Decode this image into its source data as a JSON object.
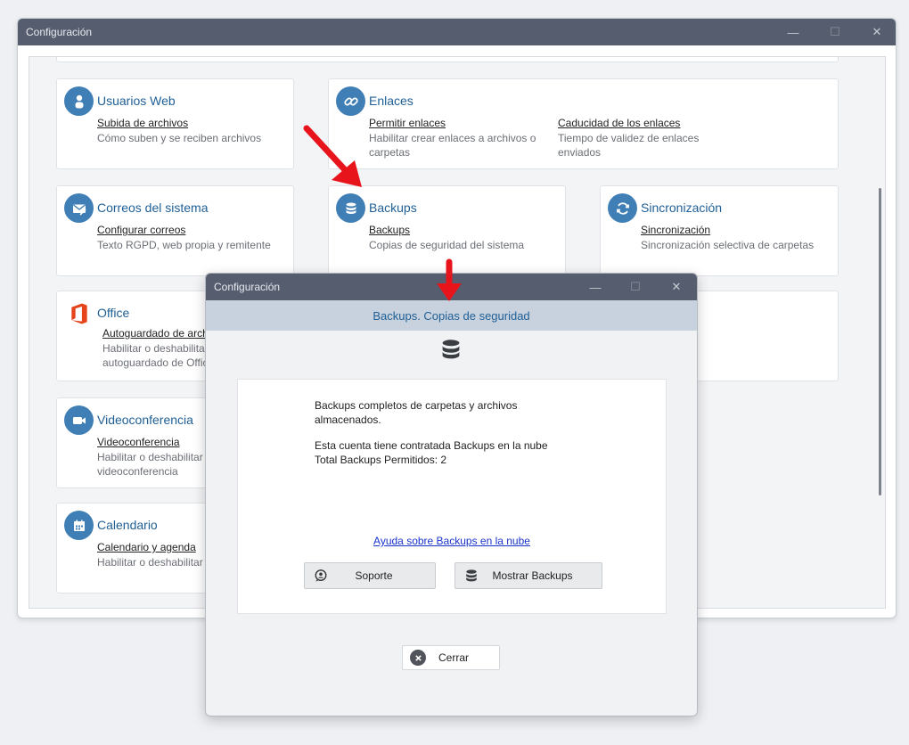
{
  "main_window": {
    "title": "Configuración",
    "controls": {
      "minimize": "—",
      "maximize": "☐",
      "close": "✕"
    }
  },
  "cards": {
    "usuarios_web": {
      "title": "Usuarios Web",
      "items": [
        {
          "link": "Subida de archivos",
          "desc": "Cómo suben y se reciben archivos"
        }
      ]
    },
    "enlaces": {
      "title": "Enlaces",
      "items": [
        {
          "link": "Permitir enlaces",
          "desc": "Habilitar crear enlaces a archivos o carpetas"
        },
        {
          "link": "Caducidad de los enlaces",
          "desc": "Tiempo de validez de enlaces enviados"
        }
      ]
    },
    "correos": {
      "title": "Correos del sistema",
      "items": [
        {
          "link": "Configurar correos",
          "desc": "Texto RGPD, web propia y remitente"
        }
      ]
    },
    "backups": {
      "title": "Backups",
      "items": [
        {
          "link": "Backups",
          "desc": "Copias de seguridad del sistema"
        }
      ]
    },
    "sincronizacion": {
      "title": "Sincronización",
      "items": [
        {
          "link": "Sincronización",
          "desc": "Sincronización selectiva de carpetas"
        }
      ]
    },
    "office": {
      "title": "Office",
      "items": [
        {
          "link": "Autoguardado de arch",
          "desc": "Habilitar o deshabilita autoguardado de Offic"
        }
      ]
    },
    "videoconferencia": {
      "title": "Videoconferencia",
      "items": [
        {
          "link": "Videoconferencia",
          "desc": "Habilitar o deshabilitar videoconferencia"
        }
      ]
    },
    "calendario": {
      "title": "Calendario",
      "items": [
        {
          "link": "Calendario y agenda",
          "desc": "Habilitar o deshabilitar C"
        }
      ]
    }
  },
  "dialog": {
    "title": "Configuración",
    "header": "Backups. Copias de seguridad",
    "paragraph1": "Backups completos de carpetas y archivos almacenados.",
    "paragraph2": "Esta cuenta tiene contratada Backups en la nube",
    "paragraph3": "Total Backups Permitidos: 2",
    "help_link": "Ayuda sobre Backups en la nube",
    "buttons": {
      "support": "Soporte",
      "show_backups": "Mostrar Backups",
      "close": "Cerrar"
    },
    "controls": {
      "minimize": "—",
      "maximize": "☐",
      "close": "✕"
    }
  },
  "colors": {
    "titlebar": "#565d6f",
    "accent": "#1f5f95",
    "icon_circle": "#3f7fb5",
    "arrow": "#e8141c",
    "office": "#e4431b",
    "link": "#1a33cc"
  },
  "icons": {
    "usuarios_web": "user-icon",
    "enlaces": "link-icon",
    "correos": "mail-icon",
    "backups": "database-icon",
    "sincronizacion": "sync-icon",
    "office": "office-icon",
    "videoconferencia": "video-camera-icon",
    "calendario": "calendar-icon"
  }
}
